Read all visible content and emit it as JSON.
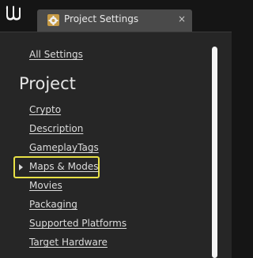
{
  "tab": {
    "title": "Project Settings",
    "close_glyph": "×",
    "icon": "settings-gear-icon"
  },
  "app": {
    "logo_icon": "unreal-engine-logo-icon"
  },
  "nav": {
    "all_settings": "All Settings",
    "section_heading": "Project",
    "items": [
      {
        "label": "Crypto"
      },
      {
        "label": "Description"
      },
      {
        "label": "GameplayTags"
      },
      {
        "label": "Maps & Modes",
        "selected": true
      },
      {
        "label": "Movies"
      },
      {
        "label": "Packaging"
      },
      {
        "label": "Supported Platforms"
      },
      {
        "label": "Target Hardware"
      }
    ]
  },
  "colors": {
    "highlight": "#e8e146",
    "background": "#151515",
    "panel": "#262626",
    "tab": "#4a4a4a"
  }
}
